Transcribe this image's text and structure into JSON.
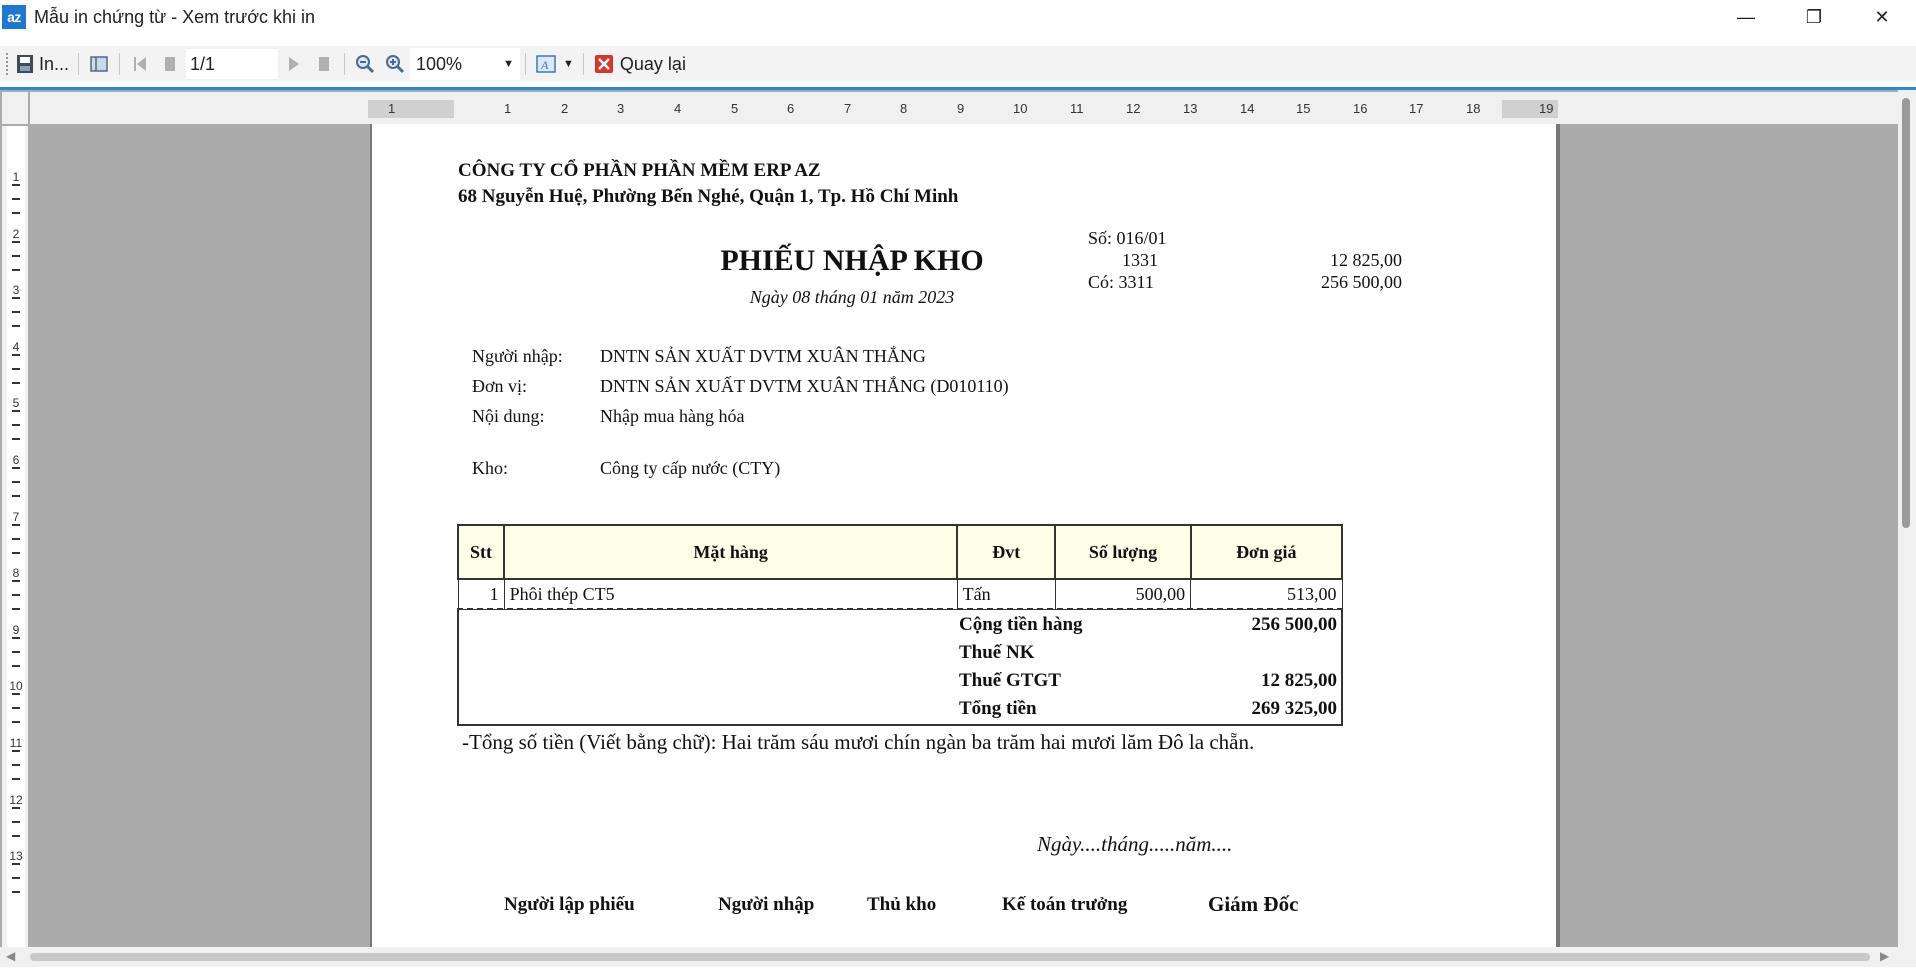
{
  "window": {
    "app_icon_text": "az",
    "title": "Mẫu in chứng từ - Xem trước khi in",
    "minimize": "—",
    "restore": "❐",
    "close": "✕"
  },
  "toolbar": {
    "print_label": "In...",
    "page_value": "1/1",
    "zoom_value": "100%",
    "back_label": "Quay lại"
  },
  "ruler": {
    "h_ticks": [
      "1",
      "1",
      "2",
      "3",
      "4",
      "5",
      "6",
      "7",
      "8",
      "9",
      "10",
      "11",
      "12",
      "13",
      "14",
      "15",
      "16",
      "17",
      "18",
      "19"
    ],
    "v_ticks": [
      "1",
      "2",
      "3",
      "4",
      "5",
      "6",
      "7",
      "8",
      "9",
      "10",
      "11",
      "12",
      "13"
    ]
  },
  "document": {
    "company": "CÔNG TY CỔ PHẦN PHẦN MỀM ERP AZ",
    "address": "68 Nguyễn Huệ, Phường Bến Nghé, Quận 1, Tp. Hồ Chí Minh",
    "doc_no": "Số: 016/01",
    "debit_account": "1331",
    "debit_amount": "12 825,00",
    "credit_account": "Có: 3311",
    "credit_amount": "256 500,00",
    "title": "PHIẾU NHẬP KHO",
    "date": "Ngày 08 tháng 01 năm 2023",
    "fields": {
      "importer_label": "Người nhập:",
      "importer_value": "DNTN SẢN XUẤT DVTM XUÂN THẮNG",
      "unit_label": "Đơn vị:",
      "unit_value": "DNTN SẢN XUẤT DVTM XUÂN THẮNG (D010110)",
      "content_label": "Nội dung:",
      "content_value": "Nhập mua hàng hóa",
      "warehouse_label": "Kho:",
      "warehouse_value": "Công ty cấp nước (CTY)"
    },
    "table": {
      "headers": [
        "Stt",
        "Mặt hàng",
        "Đvt",
        "Số lượng",
        "Đơn giá"
      ],
      "rows": [
        [
          "1",
          "Phôi thép CT5",
          "Tấn",
          "500,00",
          "513,00"
        ]
      ]
    },
    "totals": {
      "goods_label": "Cộng tiền hàng",
      "goods_value": "256 500,00",
      "import_tax_label": "Thuế NK",
      "vat_label": "Thuế GTGT",
      "vat_value": "12 825,00",
      "total_label": "Tổng tiền",
      "total_value": "269 325,00"
    },
    "amount_in_words": "-Tổng số tiền (Viết bằng chữ): Hai trăm sáu mươi chín ngàn ba trăm hai mươi lăm Đô la chẵn.",
    "sign_date": "Ngày....tháng.....năm....",
    "signatures": [
      "Người lập phiếu",
      "Người nhập",
      "Thủ kho",
      "Kế toán trưởng",
      "Giám Đốc"
    ]
  }
}
